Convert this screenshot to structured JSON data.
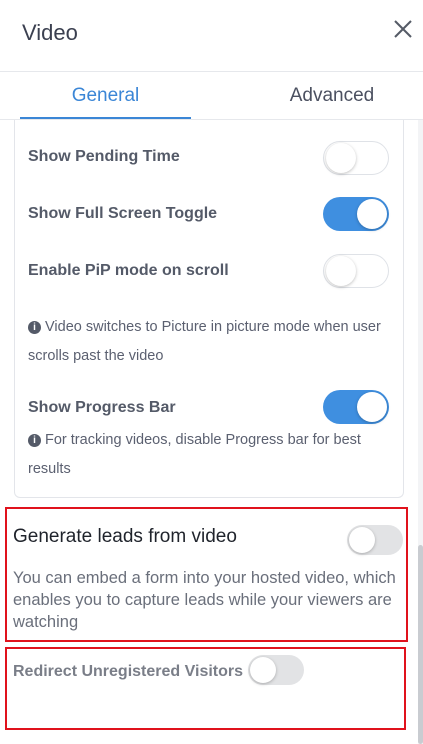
{
  "header": {
    "title": "Video",
    "close_icon": "close-icon"
  },
  "tabs": [
    {
      "label": "General",
      "active": true
    },
    {
      "label": "Advanced",
      "active": false
    }
  ],
  "settings": {
    "pending_time": {
      "label": "Show Pending Time",
      "enabled": false
    },
    "full_screen": {
      "label": "Show Full Screen Toggle",
      "enabled": true
    },
    "pip": {
      "label": "Enable PiP mode on scroll",
      "enabled": false,
      "info": "Video switches to Picture in picture mode when user scrolls past the video"
    },
    "progress_bar": {
      "label": "Show Progress Bar",
      "enabled": true,
      "info": "For tracking videos, disable Progress bar for best results"
    }
  },
  "leads": {
    "title": "Generate leads from video",
    "enabled": false,
    "description": "You can embed a form into your hosted video, which enables you to capture leads while your viewers are watching"
  },
  "redirect": {
    "label": "Redirect Unregistered Visitors",
    "enabled": false
  },
  "colors": {
    "accent": "#3f8fe0",
    "highlight": "#e0121c",
    "toggle_off": "#e2e3e5"
  }
}
